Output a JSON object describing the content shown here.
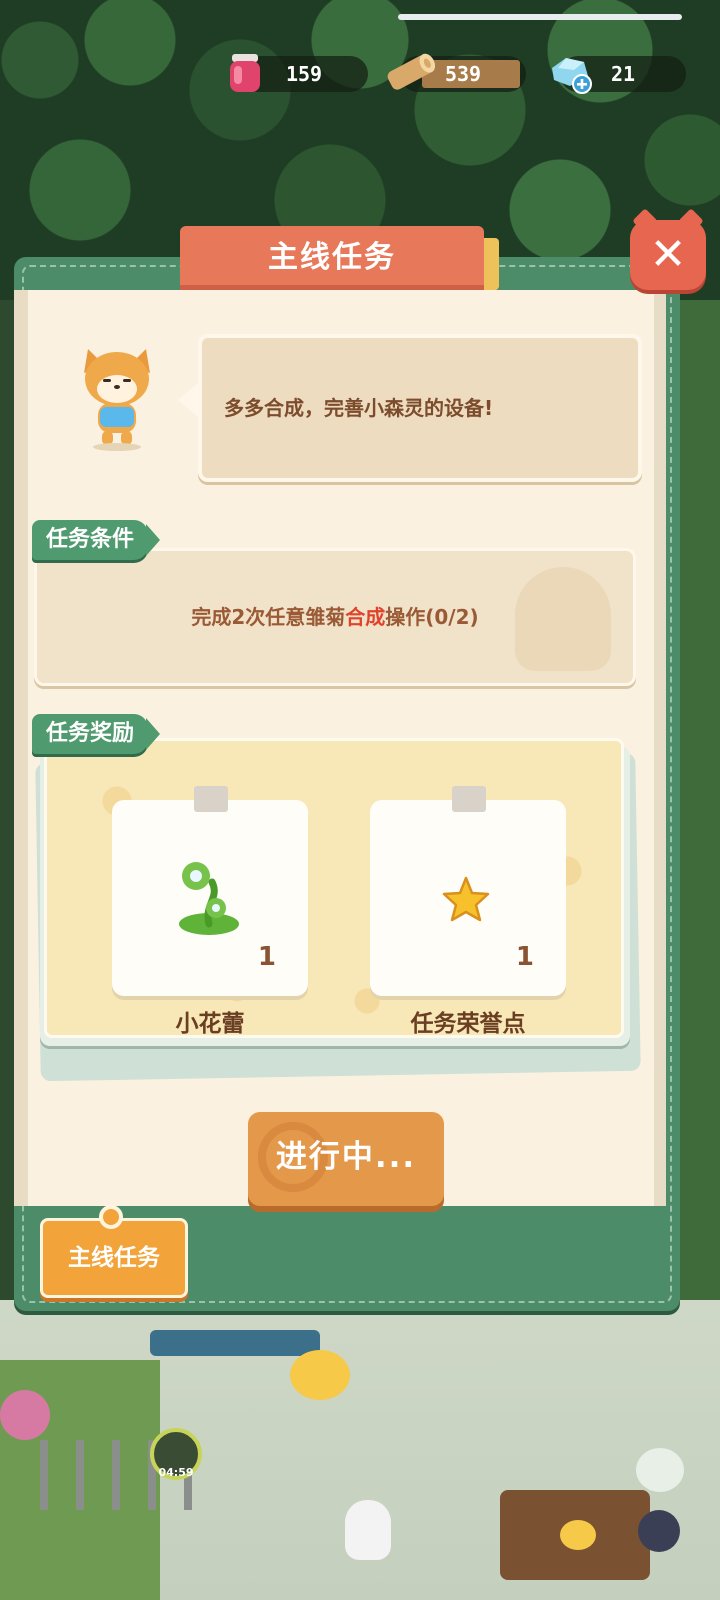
{
  "resources": {
    "jam": "159",
    "wood": "539",
    "gems": "21"
  },
  "panel": {
    "title": "主线任务",
    "close_symbol": "✕",
    "speech": "多多合成，完善小森灵的设备!"
  },
  "conditions": {
    "label": "任务条件",
    "text_prefix": "完成2次任意雏菊",
    "text_highlight": "合成",
    "text_suffix": "操作(0/2)"
  },
  "rewards": {
    "label": "任务奖励",
    "items": [
      {
        "name": "小花蕾",
        "count": "1",
        "icon": "flower-bud-icon"
      },
      {
        "name": "任务荣誉点",
        "count": "1",
        "icon": "star-icon"
      }
    ]
  },
  "action_button": {
    "label": "进行中..."
  },
  "bottom_tab": {
    "label": "主线任务"
  },
  "scene": {
    "hammer_timer": "04:59"
  },
  "colors": {
    "title_tab": "#e8785a",
    "panel_green": "#4c8c68",
    "highlight_red": "#e0432b",
    "button_orange": "#e4984a"
  }
}
